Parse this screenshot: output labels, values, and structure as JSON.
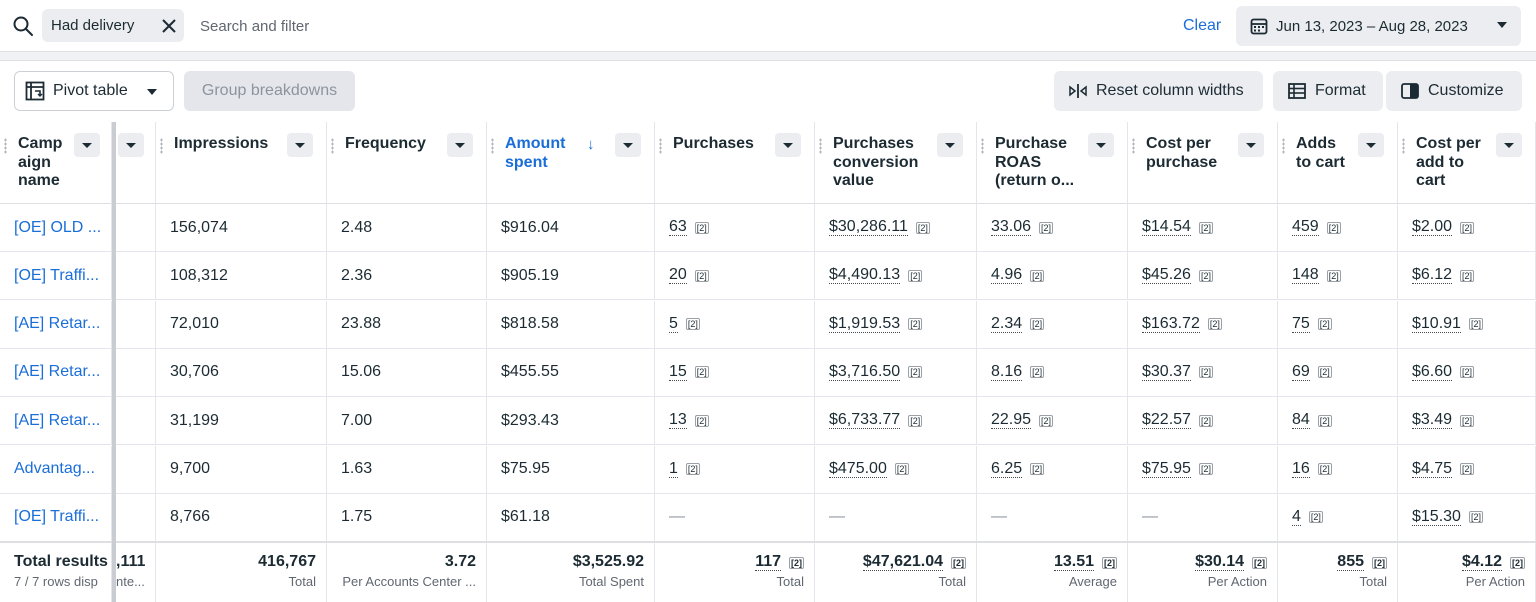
{
  "filter": {
    "chip_label": "Had delivery",
    "search_placeholder": "Search and filter",
    "clear_label": "Clear",
    "date_range": "Jun 13, 2023 – Aug 28, 2023"
  },
  "toolbar": {
    "pivot_label": "Pivot table",
    "group_breakdowns_label": "Group breakdowns",
    "reset_widths_label": "Reset column widths",
    "format_label": "Format",
    "customize_label": "Customize"
  },
  "table": {
    "headers": {
      "campaign_name": [
        "Camp",
        "aign",
        "name"
      ],
      "impressions": [
        "Impressions"
      ],
      "frequency": [
        "Frequency"
      ],
      "amount_spent": [
        "Amount",
        "spent"
      ],
      "purchases": [
        "Purchases"
      ],
      "purchases_conv_value": [
        "Purchases",
        "conversion",
        "value"
      ],
      "purchase_roas": [
        "Purchase",
        "ROAS",
        "(return o..."
      ],
      "cost_per_purchase": [
        "Cost per",
        "purchase"
      ],
      "adds_to_cart": [
        "Adds",
        "to cart"
      ],
      "cost_per_add_to_cart": [
        "Cost per",
        "add to",
        "cart"
      ]
    },
    "sort_arrow": "↓",
    "badge": "[2]",
    "dash": "—",
    "rows": [
      {
        "name": "[OE] OLD ...",
        "impressions": "156,074",
        "frequency": "2.48",
        "amount": "$916.04",
        "purchases": "63",
        "conv_value": "$30,286.11",
        "roas": "33.06",
        "cpp": "$14.54",
        "atc": "459",
        "cpatc": "$2.00"
      },
      {
        "name": "[OE] Traffi...",
        "impressions": "108,312",
        "frequency": "2.36",
        "amount": "$905.19",
        "purchases": "20",
        "conv_value": "$4,490.13",
        "roas": "4.96",
        "cpp": "$45.26",
        "atc": "148",
        "cpatc": "$6.12"
      },
      {
        "name": "[AE] Retar...",
        "impressions": "72,010",
        "frequency": "23.88",
        "amount": "$818.58",
        "purchases": "5",
        "conv_value": "$1,919.53",
        "roas": "2.34",
        "cpp": "$163.72",
        "atc": "75",
        "cpatc": "$10.91"
      },
      {
        "name": "[AE] Retar...",
        "impressions": "30,706",
        "frequency": "15.06",
        "amount": "$455.55",
        "purchases": "15",
        "conv_value": "$3,716.50",
        "roas": "8.16",
        "cpp": "$30.37",
        "atc": "69",
        "cpatc": "$6.60"
      },
      {
        "name": "[AE] Retar...",
        "impressions": "31,199",
        "frequency": "7.00",
        "amount": "$293.43",
        "purchases": "13",
        "conv_value": "$6,733.77",
        "roas": "22.95",
        "cpp": "$22.57",
        "atc": "84",
        "cpatc": "$3.49"
      },
      {
        "name": "Advantag...",
        "impressions": "9,700",
        "frequency": "1.63",
        "amount": "$75.95",
        "purchases": "1",
        "conv_value": "$475.00",
        "roas": "6.25",
        "cpp": "$75.95",
        "atc": "16",
        "cpatc": "$4.75"
      },
      {
        "name": "[OE] Traffi...",
        "impressions": "8,766",
        "frequency": "1.75",
        "amount": "$61.18",
        "purchases": null,
        "conv_value": null,
        "roas": null,
        "cpp": null,
        "atc": "4",
        "cpatc": "$15.30"
      }
    ],
    "totals": {
      "title": "Total results",
      "subtitle": "7 / 7 rows disp",
      "hidden_col_value": ",111",
      "hidden_col_label": "nte...",
      "impressions": {
        "value": "416,767",
        "label": "Total"
      },
      "frequency": {
        "value": "3.72",
        "label": "Per Accounts Center ..."
      },
      "amount": {
        "value": "$3,525.92",
        "label": "Total Spent"
      },
      "purchases": {
        "value": "117",
        "label": "Total"
      },
      "conv_value": {
        "value": "$47,621.04",
        "label": "Total"
      },
      "roas": {
        "value": "13.51",
        "label": "Average"
      },
      "cpp": {
        "value": "$30.14",
        "label": "Per Action"
      },
      "atc": {
        "value": "855",
        "label": "Total"
      },
      "cpatc": {
        "value": "$4.12",
        "label": "Per Action"
      }
    }
  },
  "colors": {
    "accent": "#1a6ed8",
    "text": "#1c2b33",
    "muted": "#606770"
  }
}
